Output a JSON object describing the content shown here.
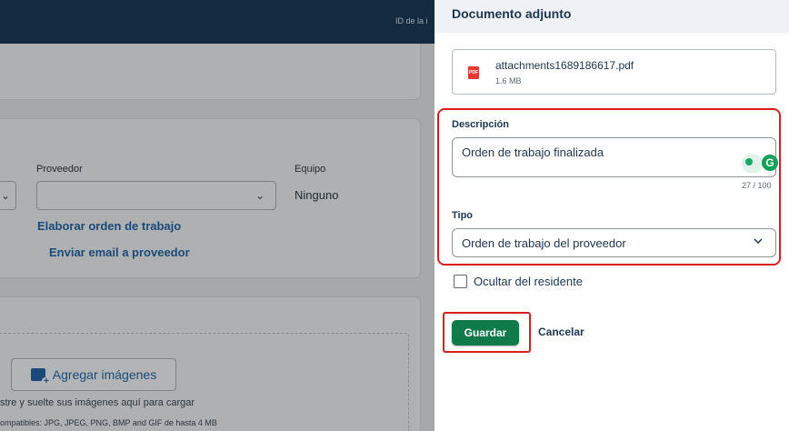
{
  "background": {
    "topbar": {
      "id_label": "ID de la i"
    },
    "proveedor": {
      "label": "Proveedor",
      "value": ""
    },
    "equipo": {
      "label": "Equipo",
      "value": "Ninguno"
    },
    "links": {
      "work_order": "Elaborar orden de trabajo",
      "email_vendor": "Enviar email a proveedor"
    },
    "images": {
      "add_button": "Agregar imágenes",
      "drop_hint": "stre y suelte sus imágenes aquí para cargar",
      "formats_hint": "ompatibles: JPG, JPEG, PNG, BMP and GIF de hasta 4 MB"
    }
  },
  "panel": {
    "title": "Documento adjunto",
    "file": {
      "icon": "pdf-icon",
      "icon_text": "PDF",
      "name": "attachments1689186617.pdf",
      "size": "1.6 MB"
    },
    "description": {
      "label": "Descripción",
      "value": "Orden de trabajo finalizada",
      "counter": "27 / 100",
      "grammarly_letter": "G"
    },
    "type": {
      "label": "Tipo",
      "value": "Orden de trabajo del proveedor"
    },
    "hide_checkbox": {
      "label": "Ocultar del residente",
      "checked": false
    },
    "save_label": "Guardar",
    "cancel_label": "Cancelar"
  },
  "colors": {
    "primary": "#117a4a",
    "highlight": "#d42020",
    "navy": "#142a40",
    "text": "#1e3550"
  }
}
